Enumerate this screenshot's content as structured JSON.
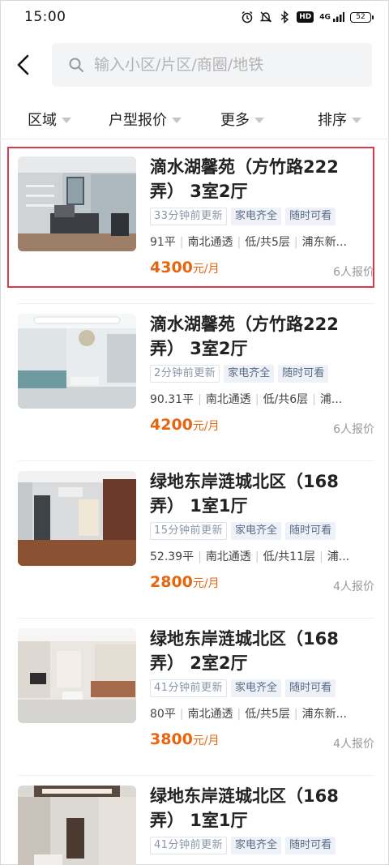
{
  "status_bar": {
    "time": "15:00",
    "network": "4G",
    "battery": "52"
  },
  "search": {
    "placeholder": "输入小区/片区/商圈/地铁"
  },
  "filters": [
    {
      "label": "区域"
    },
    {
      "label": "户型报价"
    },
    {
      "label": "更多"
    },
    {
      "label": "排序"
    }
  ],
  "listings": [
    {
      "title": "滴水湖馨苑（方竹路222弄） 3室2厅",
      "tags": [
        "33分钟前更新",
        "家电齐全",
        "随时可看"
      ],
      "info": [
        "91平",
        "南北通透",
        "低/共5层",
        "浦东新..."
      ],
      "price": "4300",
      "price_unit": "元/月",
      "quote": "6人报价"
    },
    {
      "title": "滴水湖馨苑（方竹路222弄） 3室2厅",
      "tags": [
        "2分钟前更新",
        "家电齐全",
        "随时可看"
      ],
      "info": [
        "90.31平",
        "南北通透",
        "低/共6层",
        "浦..."
      ],
      "price": "4200",
      "price_unit": "元/月",
      "quote": "6人报价"
    },
    {
      "title": "绿地东岸涟城北区（168弄） 1室1厅",
      "tags": [
        "15分钟前更新",
        "家电齐全",
        "随时可看"
      ],
      "info": [
        "52.39平",
        "南北通透",
        "低/共11层",
        "浦..."
      ],
      "price": "2800",
      "price_unit": "元/月",
      "quote": "4人报价"
    },
    {
      "title": "绿地东岸涟城北区（168弄） 2室2厅",
      "tags": [
        "41分钟前更新",
        "家电齐全",
        "随时可看"
      ],
      "info": [
        "80平",
        "南北通透",
        "低/共5层",
        "浦东新..."
      ],
      "price": "3800",
      "price_unit": "元/月",
      "quote": "4人报价"
    },
    {
      "title": "绿地东岸涟城北区（168弄） 1室1厅",
      "tags": [
        "41分钟前更新",
        "家电齐全",
        "随时可看"
      ],
      "info": [],
      "price": "",
      "price_unit": "",
      "quote": ""
    }
  ],
  "colors": {
    "price": "#e8650f",
    "highlight": "#d83a4a",
    "tag_bg": "#eef2f8"
  }
}
